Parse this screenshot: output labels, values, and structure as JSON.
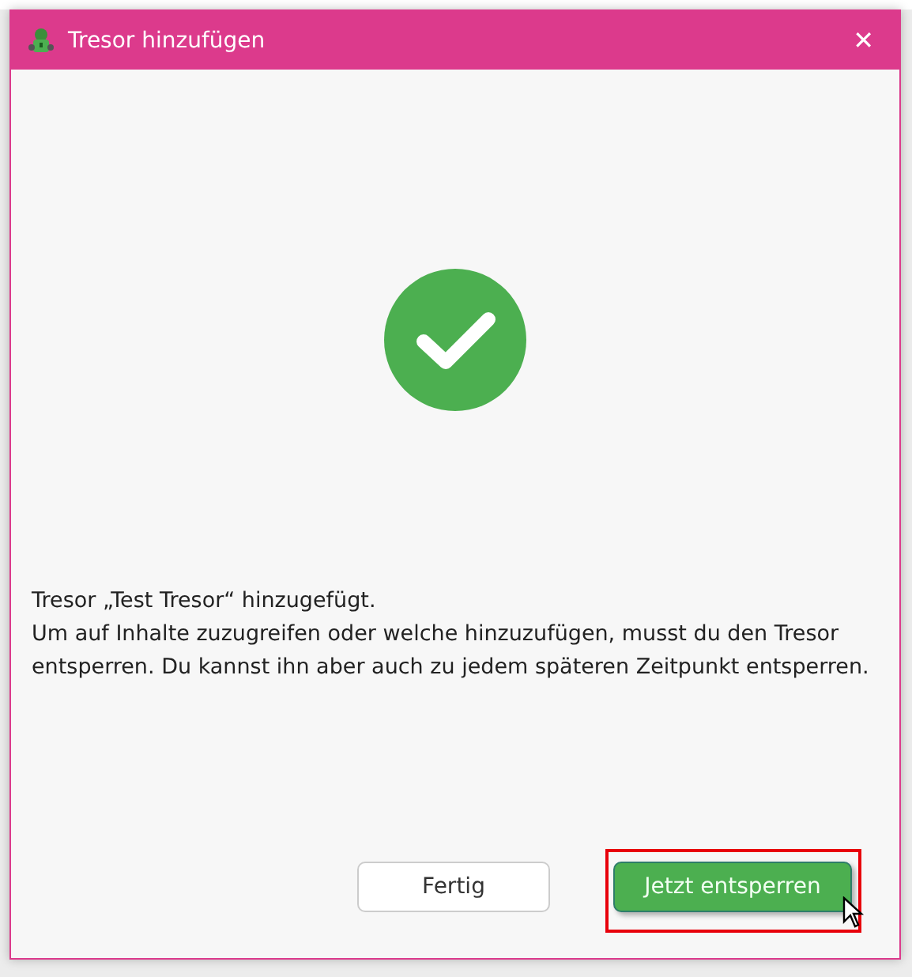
{
  "window": {
    "title": "Tresor hinzufügen",
    "close": "✕"
  },
  "message": {
    "title": "Tresor „Test Tresor“ hinzugefügt.",
    "body": "Um auf Inhalte zuzugreifen oder welche hinzuzufügen, musst du den Tresor entsperren. Du kannst ihn aber auch zu jedem späteren Zeitpunkt entsperren."
  },
  "buttons": [
    {
      "label": "Fertig",
      "kind": "secondary",
      "highlighted": false
    },
    {
      "label": "Jetzt entsperren",
      "kind": "primary",
      "highlighted": true
    }
  ]
}
